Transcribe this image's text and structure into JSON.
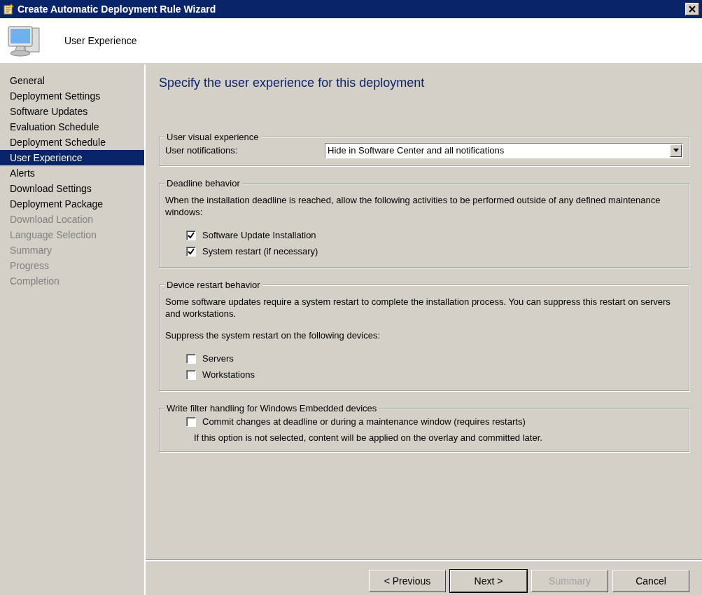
{
  "window": {
    "title": "Create Automatic Deployment Rule Wizard"
  },
  "header": {
    "title": "User Experience"
  },
  "sidebar": {
    "items": [
      {
        "label": "General",
        "selected": false,
        "disabled": false
      },
      {
        "label": "Deployment Settings",
        "selected": false,
        "disabled": false
      },
      {
        "label": "Software Updates",
        "selected": false,
        "disabled": false
      },
      {
        "label": "Evaluation Schedule",
        "selected": false,
        "disabled": false
      },
      {
        "label": "Deployment Schedule",
        "selected": false,
        "disabled": false
      },
      {
        "label": "User Experience",
        "selected": true,
        "disabled": false
      },
      {
        "label": "Alerts",
        "selected": false,
        "disabled": false
      },
      {
        "label": "Download Settings",
        "selected": false,
        "disabled": false
      },
      {
        "label": "Deployment Package",
        "selected": false,
        "disabled": false
      },
      {
        "label": "Download Location",
        "selected": false,
        "disabled": true
      },
      {
        "label": "Language Selection",
        "selected": false,
        "disabled": true
      },
      {
        "label": "Summary",
        "selected": false,
        "disabled": true
      },
      {
        "label": "Progress",
        "selected": false,
        "disabled": true
      },
      {
        "label": "Completion",
        "selected": false,
        "disabled": true
      }
    ]
  },
  "page": {
    "heading": "Specify the user experience for this deployment"
  },
  "groups": [
    {
      "legend": "User visual experience",
      "items": [
        {
          "kind": "select",
          "label": "User notifications:",
          "value": "Hide in Software Center and all notifications"
        }
      ]
    },
    {
      "legend": "Deadline behavior",
      "items": [
        {
          "kind": "text",
          "text": "When the installation deadline is reached, allow the following activities to be performed outside of any defined maintenance windows:"
        },
        {
          "kind": "checkbox",
          "label": "Software Update Installation",
          "checked": true
        },
        {
          "kind": "checkbox",
          "label": "System restart (if necessary)",
          "checked": true
        }
      ]
    },
    {
      "legend": "Device restart behavior",
      "items": [
        {
          "kind": "text",
          "text": "Some software updates require a system restart to complete the installation process. You can suppress this restart on servers and workstations."
        },
        {
          "kind": "text",
          "text": "Suppress the system restart on the following devices:"
        },
        {
          "kind": "checkbox",
          "label": "Servers",
          "checked": false
        },
        {
          "kind": "checkbox",
          "label": "Workstations",
          "checked": false
        }
      ]
    },
    {
      "legend": "Write filter handling for Windows Embedded devices",
      "items": [
        {
          "kind": "checkbox",
          "label": "Commit changes at deadline or during a maintenance window (requires restarts)",
          "checked": false
        },
        {
          "kind": "note",
          "text": "If this option is not selected, content will be applied on the overlay and committed later."
        }
      ]
    }
  ],
  "buttons": [
    {
      "label": "< Previous",
      "disabled": false,
      "default": false
    },
    {
      "label": "Next >",
      "disabled": false,
      "default": true
    },
    {
      "label": "Summary",
      "disabled": true,
      "default": false
    },
    {
      "label": "Cancel",
      "disabled": false,
      "default": false
    }
  ]
}
